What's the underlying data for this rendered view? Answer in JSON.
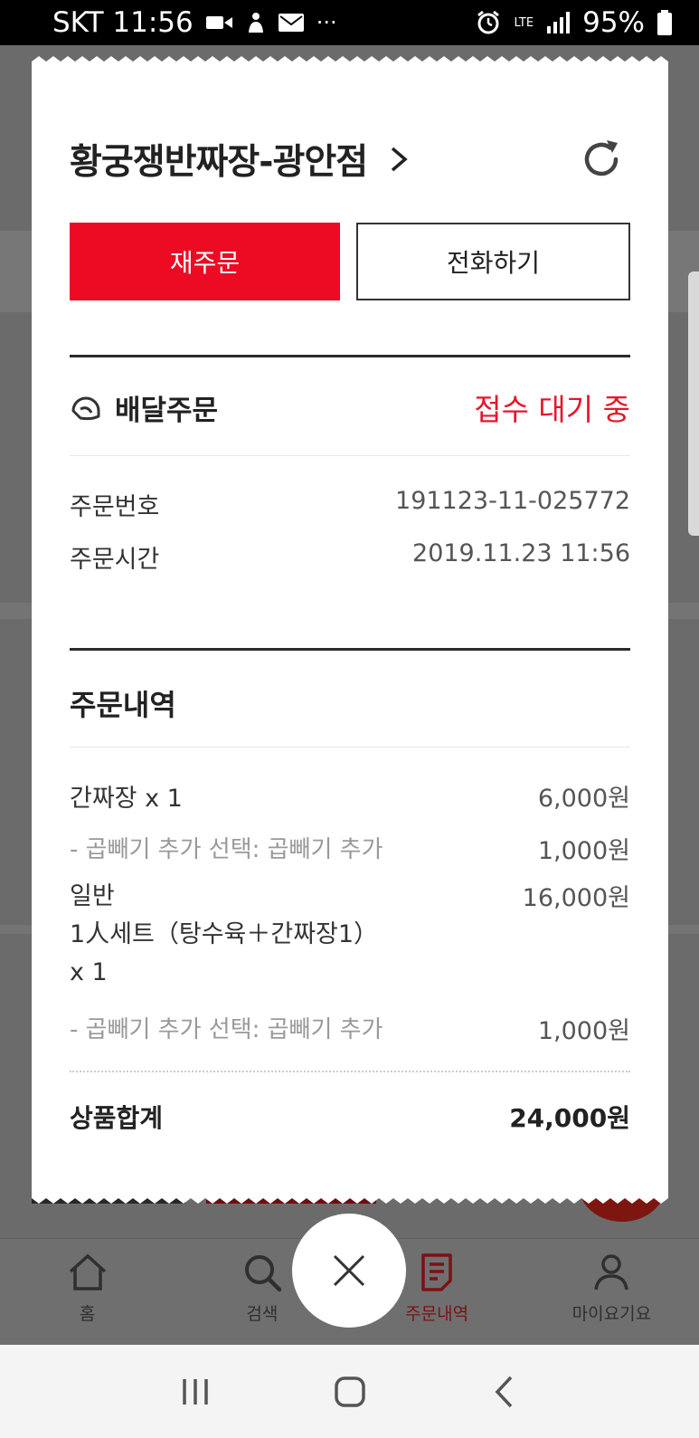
{
  "status_bar": {
    "carrier_time": "SKT 11:56",
    "more": "···",
    "network": "LTE",
    "battery": "95%"
  },
  "receipt": {
    "store_name": "황궁쟁반짜장-광안점",
    "buttons": {
      "reorder": "재주문",
      "call": "전화하기"
    },
    "delivery": {
      "label": "배달주문",
      "status": "접수 대기 중"
    },
    "info": [
      {
        "label": "주문번호",
        "value": "191123-11-025772"
      },
      {
        "label": "주문시간",
        "value": "2019.11.23 11:56"
      }
    ],
    "section_title": "주문내역",
    "items": [
      {
        "name": "간짜장 x 1",
        "price": "6,000원"
      },
      {
        "option": "- 곱빼기 추가 선택: 곱빼기 추가",
        "price": "1,000원"
      },
      {
        "line1": "일반",
        "line2": "1人세트（탕수육＋간짜장1）",
        "line3": "x 1",
        "price": "16,000원"
      },
      {
        "option": "- 곱빼기 추가 선택: 곱빼기 추가",
        "price": "1,000원"
      }
    ],
    "total": {
      "label": "상품합계",
      "value": "24,000원"
    }
  },
  "bottom_nav": [
    {
      "label": "홈",
      "icon": "home-icon"
    },
    {
      "label": "검색",
      "icon": "search-icon"
    },
    {
      "label": "주문내역",
      "icon": "order-list-icon",
      "active": true
    },
    {
      "label": "마이요기요",
      "icon": "user-icon"
    }
  ],
  "colors": {
    "accent_red": "#ec0b23",
    "status_red": "#e5162d",
    "active_nav": "#7d1115"
  }
}
